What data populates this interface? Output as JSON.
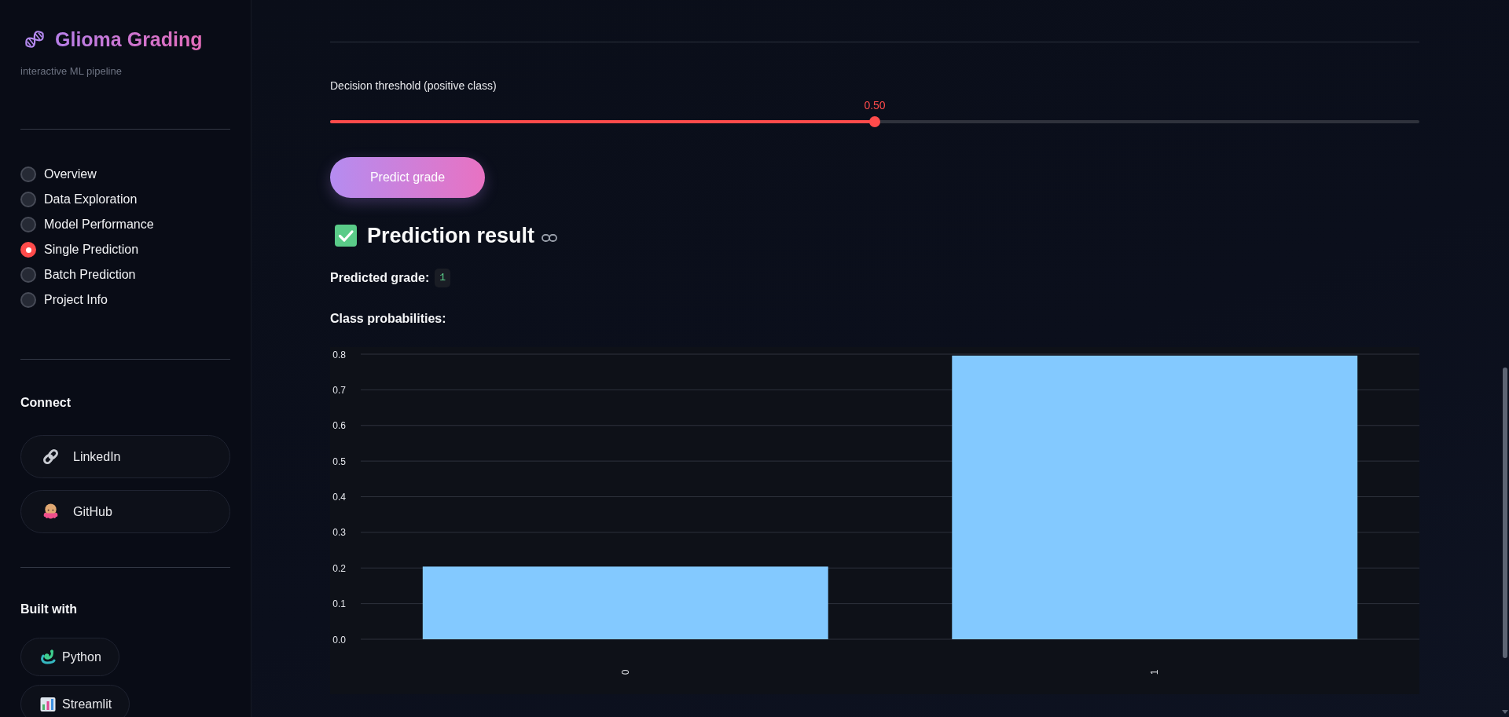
{
  "sidebar": {
    "title": "Glioma Grading",
    "subtitle": "interactive ML pipeline",
    "nav": [
      {
        "label": "Overview",
        "selected": false
      },
      {
        "label": "Data Exploration",
        "selected": false
      },
      {
        "label": "Model Performance",
        "selected": false
      },
      {
        "label": "Single Prediction",
        "selected": true
      },
      {
        "label": "Batch Prediction",
        "selected": false
      },
      {
        "label": "Project Info",
        "selected": false
      }
    ],
    "connect": {
      "heading": "Connect",
      "links": [
        {
          "label": "LinkedIn",
          "kind": "chain"
        },
        {
          "label": "GitHub",
          "kind": "octopus"
        }
      ]
    },
    "built_with": {
      "heading": "Built with",
      "items": [
        {
          "label": "Python",
          "kind": "snake"
        },
        {
          "label": "Streamlit",
          "kind": "chart"
        }
      ]
    }
  },
  "main": {
    "threshold": {
      "label": "Decision threshold (positive class)",
      "reading": "0.50",
      "level": 0.5
    },
    "predict_button": "Predict grade",
    "result": {
      "heading": "Prediction result",
      "predicted_label": "Predicted grade:",
      "predicted_value": "1",
      "probabilities_label": "Class probabilities:",
      "chart_data": {
        "type": "bar",
        "categories": [
          "0",
          "1"
        ],
        "values": [
          0.204,
          0.796
        ],
        "ylim": [
          0,
          0.8
        ],
        "yticks": [
          {
            "value": 0,
            "label": "0.0"
          },
          0.1,
          0.2,
          0.3,
          0.4,
          0.5,
          0.6,
          0.7,
          0.8
        ],
        "grid": true
      }
    }
  }
}
